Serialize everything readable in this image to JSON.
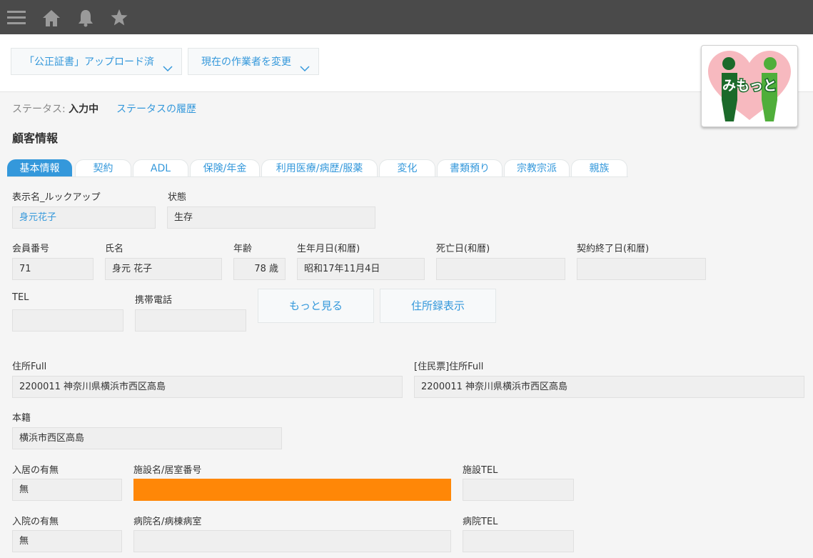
{
  "topbar": {
    "icons": [
      "menu-icon",
      "home-icon",
      "bell-icon",
      "star-icon"
    ]
  },
  "header": {
    "action_button": "「公正証書」アップロード済",
    "assignee_button": "現在の作業者を変更",
    "logo_text": "みもっと"
  },
  "status": {
    "label": "ステータス:",
    "value": "入力中",
    "history_link": "ステータスの履歴"
  },
  "section_title": "顧客情報",
  "tabs": [
    "基本情報",
    "契約",
    "ADL",
    "保険/年金",
    "利用医療/病歴/服薬",
    "変化",
    "書類預り",
    "宗教宗派",
    "親族"
  ],
  "fields": {
    "display_name": {
      "label": "表示名_ルックアップ",
      "value": "身元花子"
    },
    "state": {
      "label": "状態",
      "value": "生存"
    },
    "member_no": {
      "label": "会員番号",
      "value": "71"
    },
    "name": {
      "label": "氏名",
      "value": "身元 花子"
    },
    "age": {
      "label": "年齢",
      "value": "78 歳"
    },
    "birthdate": {
      "label": "生年月日(和暦)",
      "value": "昭和17年11月4日"
    },
    "death_date": {
      "label": "死亡日(和暦)",
      "value": ""
    },
    "contract_end": {
      "label": "契約終了日(和暦)",
      "value": ""
    },
    "tel": {
      "label": "TEL",
      "value": ""
    },
    "mobile": {
      "label": "携帯電話",
      "value": ""
    },
    "address": {
      "label": "住所Full",
      "value": "2200011 神奈川県横浜市西区高島"
    },
    "resident_address": {
      "label": "[住民票]住所Full",
      "value": "2200011 神奈川県横浜市西区高島"
    },
    "honseki": {
      "label": "本籍",
      "value": "横浜市西区高島"
    },
    "facility_presence": {
      "label": "入居の有無",
      "value": "無"
    },
    "facility_name": {
      "label": "施設名/居室番号",
      "value": ""
    },
    "facility_tel": {
      "label": "施設TEL",
      "value": ""
    },
    "hospital_presence": {
      "label": "入院の有無",
      "value": "無"
    },
    "hospital_name": {
      "label": "病院名/病棟病室",
      "value": ""
    },
    "hospital_tel": {
      "label": "病院TEL",
      "value": ""
    }
  },
  "buttons": {
    "more": "もっと見る",
    "address_book": "住所録表示"
  },
  "colors": {
    "accent": "#3498db",
    "highlight": "#ff8707",
    "topbar": "#4a4a4a"
  }
}
